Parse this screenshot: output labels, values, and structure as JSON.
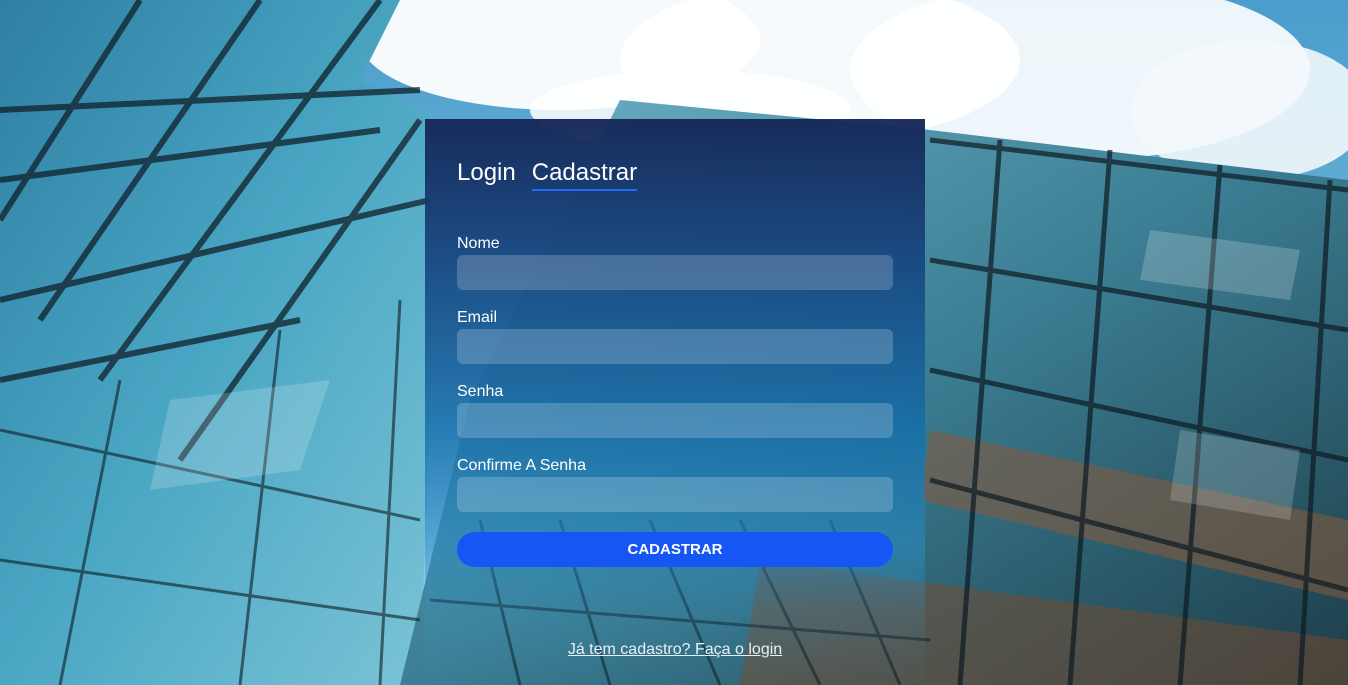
{
  "tabs": [
    {
      "label": "Login",
      "active": false
    },
    {
      "label": "Cadastrar",
      "active": true
    }
  ],
  "form": {
    "name_label": "Nome",
    "email_label": "Email",
    "password_label": "Senha",
    "confirm_label": "Confirme A Senha",
    "name_value": "",
    "email_value": "",
    "password_value": "",
    "confirm_value": "",
    "submit_label": "CADASTRAR"
  },
  "footer": {
    "login_link": "Já tem cadastro? Faça o login"
  },
  "colors": {
    "accent": "#1656f5",
    "panel_top": "#162858"
  }
}
